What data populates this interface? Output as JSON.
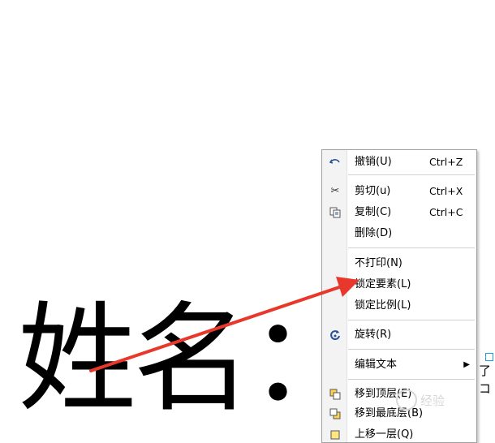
{
  "canvas_text": {
    "name_label": "姓名："
  },
  "context_menu": {
    "items": [
      {
        "icon": "undo-icon",
        "label": "撤销(U)",
        "shortcut": "Ctrl+Z"
      },
      {
        "icon": "scissors-icon",
        "label": "剪切(u)",
        "shortcut": "Ctrl+X"
      },
      {
        "icon": "copy-icon",
        "label": "复制(C)",
        "shortcut": "Ctrl+C"
      },
      {
        "icon": "",
        "label": "删除(D)",
        "shortcut": ""
      },
      {
        "icon": "",
        "label": "不打印(N)",
        "shortcut": ""
      },
      {
        "icon": "",
        "label": "锁定要素(L)",
        "shortcut": ""
      },
      {
        "icon": "",
        "label": "锁定比例(L)",
        "shortcut": ""
      },
      {
        "icon": "rotate-icon",
        "label": "旋转(R)",
        "shortcut": ""
      },
      {
        "icon": "",
        "label": "编辑文本",
        "shortcut": "",
        "submenu": true
      },
      {
        "icon": "bring-to-front-icon",
        "label": "移到顶层(E)",
        "shortcut": ""
      },
      {
        "icon": "send-to-back-icon",
        "label": "移到最底层(B)",
        "shortcut": ""
      },
      {
        "icon": "move-up-icon",
        "label": "上移一层(Q)",
        "shortcut": ""
      }
    ]
  },
  "side_glyphs": {
    "first": "了",
    "second": "コ"
  },
  "watermark": {
    "text": "经验"
  },
  "annotation": {
    "color": "#e8382c"
  }
}
